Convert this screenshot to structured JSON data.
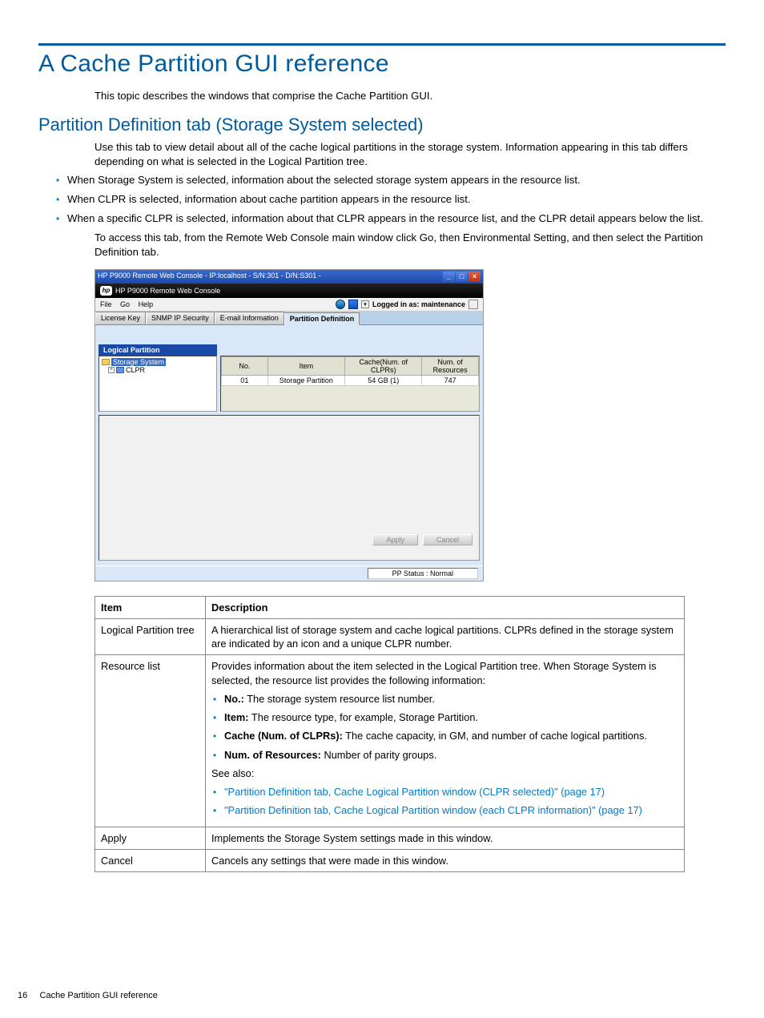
{
  "page": {
    "title": "A Cache Partition GUI reference",
    "intro": "This topic describes the windows that comprise the Cache Partition GUI.",
    "section_title": "Partition Definition tab (Storage System selected)",
    "section_p1": "Use this tab to view detail about all of the cache logical partitions in the storage system. Information appearing in this tab differs depending on what is selected in the Logical Partition tree.",
    "bullets": [
      "When Storage System is selected, information about the selected storage system appears in the resource list.",
      "When CLPR is selected, information about cache partition appears in the resource list.",
      "When a specific CLPR is selected, information about that CLPR appears in the resource list, and the CLPR detail appears below the list."
    ],
    "section_p2": "To access this tab, from the Remote Web Console main window click Go, then Environmental Setting, and then select the Partition Definition tab.",
    "footer_num": "16",
    "footer_txt": "Cache Partition GUI reference"
  },
  "shot": {
    "title": "HP P9000 Remote Web Console - IP:localhost - S/N:301 - D/N:S301 - ",
    "subtitle": "HP P9000 Remote Web Console",
    "menu_file": "File",
    "menu_go": "Go",
    "menu_help": "Help",
    "login_label": "Logged in as: maintenance",
    "tab_l": "License Key",
    "tab_s": "SNMP IP Security",
    "tab_e": "E-mail Information",
    "tab_p": "Partition Definition",
    "tree_header": "Logical Partition",
    "tree_root": "Storage System",
    "tree_clpr": "CLPR",
    "grid_h_no": "No.",
    "grid_h_item": "Item",
    "grid_h_cache": "Cache(Num. of CLPRs)",
    "grid_h_res": "Num. of Resources",
    "grid_c_no": "01",
    "grid_c_item": "Storage Partition",
    "grid_c_cache": "54 GB (1)",
    "grid_c_res": "747",
    "btn_apply": "Apply",
    "btn_cancel": "Cancel",
    "pp_status": "PP Status : Normal"
  },
  "table": {
    "h1": "Item",
    "h2": "Description",
    "r1c1": "Logical Partition tree",
    "r1c2": "A hierarchical list of storage system and cache logical partitions. CLPRs defined in the storage system are indicated by an icon and a unique CLPR number.",
    "r2c1": "Resource list",
    "r2c2_intro": "Provides information about the item selected in the Logical Partition tree. When Storage System is selected, the resource list provides the following information:",
    "r2_no_b": "No.:",
    "r2_no_t": " The storage system resource list number.",
    "r2_item_b": "Item:",
    "r2_item_t": " The resource type, for example, Storage Partition.",
    "r2_cache_b": "Cache (Num. of CLPRs):",
    "r2_cache_t": " The cache capacity, in GM, and number of cache logical partitions.",
    "r2_res_b": "Num. of Resources:",
    "r2_res_t": " Number of parity groups.",
    "r2_see": "See also:",
    "r2_link1": "\"Partition Definition tab, Cache Logical Partition window (CLPR selected)\" (page 17)",
    "r2_link2": "\"Partition Definition tab, Cache Logical Partition window (each CLPR information)\" (page 17)",
    "r3c1": "Apply",
    "r3c2": "Implements the Storage System settings made in this window.",
    "r4c1": "Cancel",
    "r4c2": "Cancels any settings that were made in this window."
  }
}
